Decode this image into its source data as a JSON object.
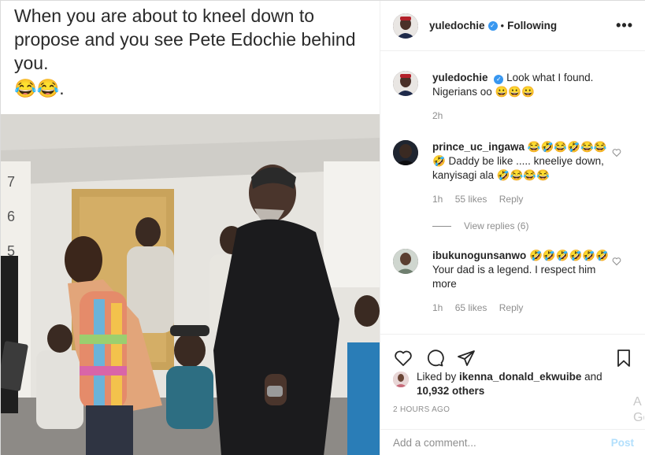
{
  "post": {
    "caption_text": "When you are about to kneel down to propose and you see Pete Edochie behind you.",
    "caption_emoji": "😂😂."
  },
  "header": {
    "username": "yuledochie",
    "verified_mark": "✓",
    "separator": "•",
    "follow_label": "Following",
    "more_label": "•••"
  },
  "owner_comment": {
    "username": "yuledochie",
    "text": "Look what I found. Nigerians oo 😀😀😀",
    "time": "2h"
  },
  "comments": [
    {
      "username": "prince_uc_ingawa",
      "text": "😂🤣😂🤣😂😂🤣 Daddy be like ..... kneeliye down, kanyisagi ala 🤣😂😂😂",
      "time": "1h",
      "likes": "55 likes",
      "reply": "Reply",
      "view_replies": "View replies (6)"
    },
    {
      "username": "ibukunogunsanwo",
      "text": "🤣🤣🤣🤣🤣🤣 Your dad is a legend. I respect him more",
      "time": "1h",
      "likes": "65 likes",
      "reply": "Reply"
    }
  ],
  "likes": {
    "prefix": "Liked by ",
    "user": "ikenna_donald_ekwuibe",
    "mid": " and",
    "count": "10,932 others"
  },
  "timestamp": "2 HOURS AGO",
  "add_comment": {
    "placeholder": "Add a comment...",
    "post_label": "Post"
  },
  "edge_text": "A Go",
  "colors": {
    "verified": "#3897f0",
    "muted": "#8e8e8e",
    "post_disabled": "#b2dffc"
  },
  "icons": [
    "heart-icon",
    "comment-icon",
    "share-icon",
    "bookmark-icon",
    "verified-badge-icon",
    "like-heart-icon",
    "more-icon"
  ]
}
